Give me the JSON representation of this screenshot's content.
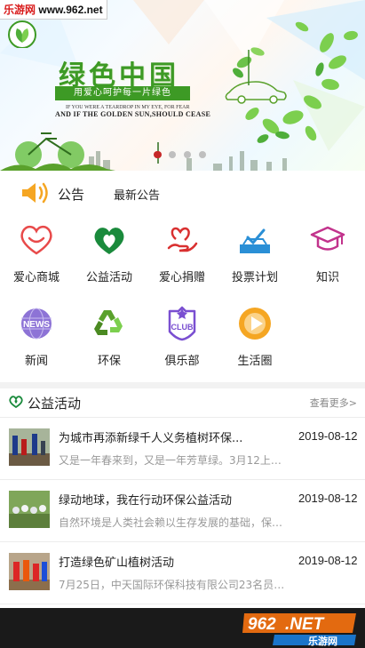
{
  "watermark": {
    "site": "乐游网",
    "url": "www.962.net"
  },
  "banner": {
    "title": "绿色中国",
    "subtitle": "用爱心呵护每一片绿色",
    "en_line1": "IF YOU WERE A TEARDROP IN MY EYE, FOR FEAR",
    "en_line2": "AND IF THE GOLDEN SUN,SHOULD CEASE",
    "slides": 4,
    "active_slide": 1
  },
  "notice": {
    "label": "公告",
    "text": "最新公告"
  },
  "grid": [
    {
      "label": "爱心商城",
      "icon": "heart-smile-icon",
      "color": "#e84a4a"
    },
    {
      "label": "公益活动",
      "icon": "heart-leaf-icon",
      "color": "#1a8a3c"
    },
    {
      "label": "爱心捐赠",
      "icon": "hand-heart-icon",
      "color": "#d93030"
    },
    {
      "label": "投票计划",
      "icon": "vote-box-icon",
      "color": "#2a8fd6"
    },
    {
      "label": "知识",
      "icon": "graduation-cap-icon",
      "color": "#c2338c"
    },
    {
      "label": "新闻",
      "icon": "news-globe-icon",
      "color": "#7a5bc9"
    },
    {
      "label": "环保",
      "icon": "recycle-icon",
      "color": "#5aa12c"
    },
    {
      "label": "俱乐部",
      "icon": "club-badge-icon",
      "color": "#7a4fd1"
    },
    {
      "label": "生活圈",
      "icon": "play-circle-icon",
      "color": "#f5a623"
    }
  ],
  "section": {
    "title": "公益活动",
    "more": "查看更多>"
  },
  "activities": [
    {
      "title": "为城市再添新绿千人义务植树环保...",
      "date": "2019-08-12",
      "desc": "又是一年春来到，又是一年芳草绿。3月12上午..."
    },
    {
      "title": "绿动地球，我在行动环保公益活动",
      "date": "2019-08-12",
      "desc": "自然环境是人类社会赖以生存发展的基础，保护..."
    },
    {
      "title": "打造绿色矿山植树活动",
      "date": "2019-08-12",
      "desc": "7月25日，中天国际环保科技有限公司23名员工..."
    }
  ],
  "badge": {
    "number": "962",
    "suffix": ".NET",
    "name": "乐游网"
  }
}
